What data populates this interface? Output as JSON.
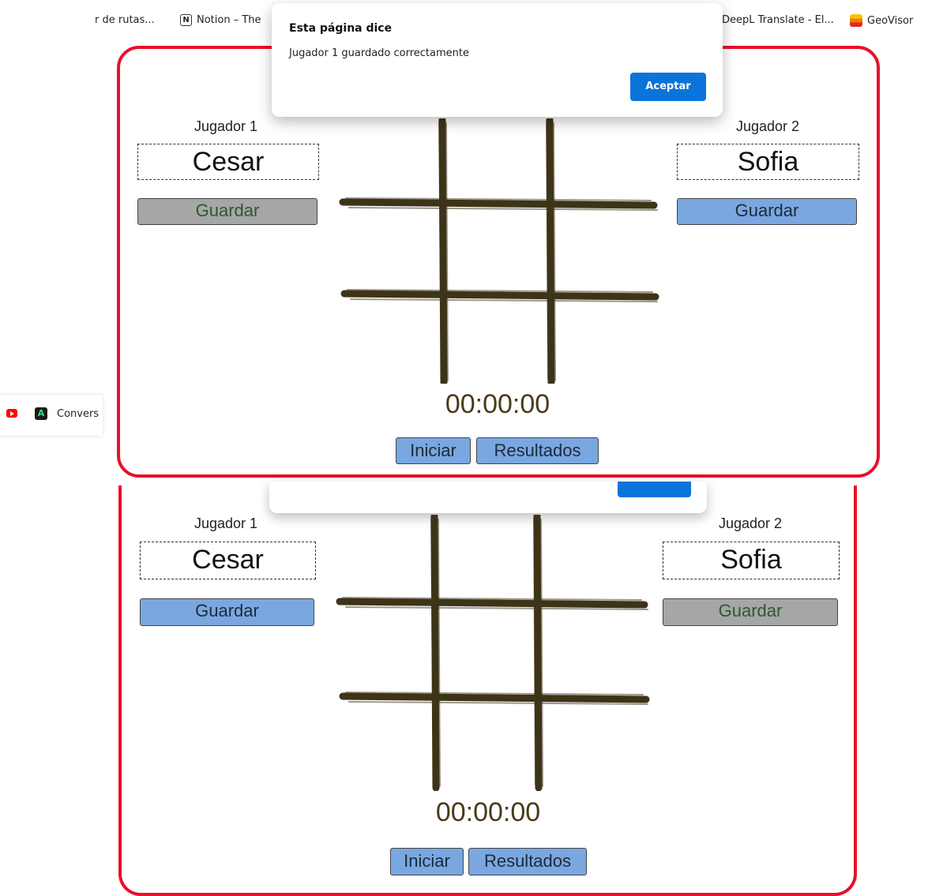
{
  "bookmarks": [
    {
      "label": "r de rutas...",
      "icon": ""
    },
    {
      "label": "Notion – The",
      "icon": "notion-icon"
    },
    {
      "label": "DeepL Translate - El...",
      "icon": ""
    },
    {
      "label": "GeoVisor",
      "icon": "geovisor-icon"
    }
  ],
  "side_bookmarks": {
    "youtube_icon": "youtube-icon",
    "conversor_label": "Convers",
    "conversor_icon": "conversor-icon"
  },
  "dialog": {
    "title": "Esta página dice",
    "message": "Jugador 1 guardado correctamente",
    "ok_label": "Aceptar"
  },
  "game_top": {
    "player1_label": "Jugador 1",
    "player1_name": "Cesar",
    "player1_save": "Guardar",
    "player1_save_state": "disabled",
    "player2_label": "Jugador 2",
    "player2_name": "Sofia",
    "player2_save": "Guardar",
    "player2_save_state": "enabled",
    "timer": "00:00:00",
    "start_label": "Iniciar",
    "results_label": "Resultados"
  },
  "game_bottom": {
    "player1_label": "Jugador 1",
    "player1_name": "Cesar",
    "player1_save": "Guardar",
    "player1_save_state": "enabled",
    "player2_label": "Jugador 2",
    "player2_name": "Sofia",
    "player2_save": "Guardar",
    "player2_save_state": "disabled",
    "timer": "00:00:00",
    "start_label": "Iniciar",
    "results_label": "Resultados"
  },
  "colors": {
    "panel_border": "#e8102a",
    "button_blue": "#7aa7e0",
    "button_gray": "#a6a6a6",
    "board_lines": "#3d3418",
    "dialog_accent": "#0a74da"
  }
}
